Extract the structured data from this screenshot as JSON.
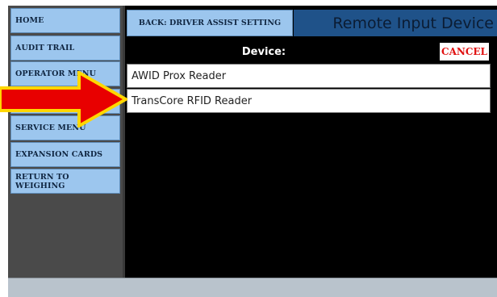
{
  "sidebar": {
    "items": [
      {
        "label": "HOME"
      },
      {
        "label": "AUDIT TRAIL"
      },
      {
        "label": "OPERATOR MENU"
      },
      {
        "label": ""
      },
      {
        "label": "SERVICE MENU"
      },
      {
        "label": "EXPANSION CARDS"
      },
      {
        "label": "RETURN TO WEIGHING"
      }
    ]
  },
  "header": {
    "back_label": "BACK: DRIVER ASSIST SETTING",
    "title": "Remote Input Device"
  },
  "main": {
    "device_label": "Device:",
    "cancel_label": "CANCEL",
    "devices": [
      {
        "label": "AWID Prox Reader"
      },
      {
        "label": "TransCore RFID Reader"
      }
    ]
  },
  "annotation": {
    "arrow_icon": "red-arrow-icon",
    "arrow_fill": "#e80000",
    "arrow_stroke": "#ffd700"
  },
  "colors": {
    "nav_button_bg": "#9cc6ee",
    "title_bar_bg": "#1f5289",
    "cancel_text": "#e01010"
  }
}
